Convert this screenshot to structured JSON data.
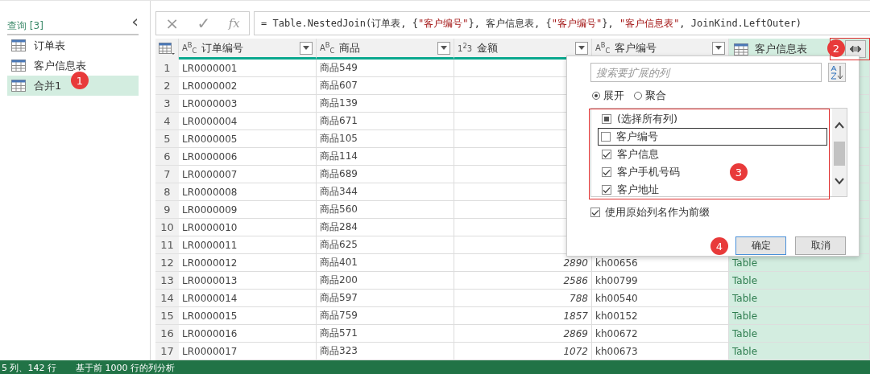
{
  "sidebar": {
    "title": "查询 [3]",
    "collapse": "‹",
    "items": [
      {
        "label": "订单表",
        "selected": false
      },
      {
        "label": "客户信息表",
        "selected": false
      },
      {
        "label": "合并1",
        "selected": true
      }
    ]
  },
  "formula_bar": {
    "cancel": "×",
    "confirm": "✓",
    "fx": "fx",
    "segments": [
      {
        "kind": "code",
        "text": "= Table.NestedJoin(订单表, {"
      },
      {
        "kind": "string",
        "text": "\"客户编号\""
      },
      {
        "kind": "code",
        "text": "}, 客户信息表, {"
      },
      {
        "kind": "string",
        "text": "\"客户编号\""
      },
      {
        "kind": "code",
        "text": "}, "
      },
      {
        "kind": "string",
        "text": "\"客户信息表\""
      },
      {
        "kind": "code",
        "text": ", JoinKind.LeftOuter)"
      }
    ]
  },
  "table": {
    "columns": [
      {
        "kind": "text",
        "type_label": "A$^{B}$$_{C}$",
        "name": "订单编号"
      },
      {
        "kind": "text",
        "type_label": "A$^{B}$$_{C}$",
        "name": "商品"
      },
      {
        "kind": "number",
        "type_label": "1$^{2}$3",
        "name": "金额"
      },
      {
        "kind": "text",
        "type_label": "A$^{B}$$_{C}$",
        "name": "客户编号"
      },
      {
        "kind": "table",
        "name": "客户信息表"
      }
    ],
    "rows": [
      {
        "n": "1",
        "cells": [
          "LR0000001",
          "商品549"
        ]
      },
      {
        "n": "2",
        "cells": [
          "LR0000002",
          "商品607"
        ]
      },
      {
        "n": "3",
        "cells": [
          "LR0000003",
          "商品139"
        ]
      },
      {
        "n": "4",
        "cells": [
          "LR0000004",
          "商品671"
        ]
      },
      {
        "n": "5",
        "cells": [
          "LR0000005",
          "商品105"
        ]
      },
      {
        "n": "6",
        "cells": [
          "LR0000006",
          "商品114"
        ]
      },
      {
        "n": "7",
        "cells": [
          "LR0000007",
          "商品689"
        ]
      },
      {
        "n": "8",
        "cells": [
          "LR0000008",
          "商品344"
        ]
      },
      {
        "n": "9",
        "cells": [
          "LR0000009",
          "商品560"
        ]
      },
      {
        "n": "10",
        "cells": [
          "LR0000010",
          "商品284"
        ]
      },
      {
        "n": "11",
        "cells": [
          "LR0000011",
          "商品625"
        ]
      },
      {
        "n": "12",
        "cells": [
          "LR0000012",
          "商品401",
          "2890",
          "kh00656",
          "Table"
        ]
      },
      {
        "n": "13",
        "cells": [
          "LR0000013",
          "商品200",
          "2586",
          "kh00799",
          "Table"
        ]
      },
      {
        "n": "14",
        "cells": [
          "LR0000014",
          "商品597",
          "788",
          "kh00540",
          "Table"
        ]
      },
      {
        "n": "15",
        "cells": [
          "LR0000015",
          "商品759",
          "1857",
          "kh00152",
          "Table"
        ]
      },
      {
        "n": "16",
        "cells": [
          "LR0000016",
          "商品571",
          "2869",
          "kh00672",
          "Table"
        ]
      },
      {
        "n": "17",
        "cells": [
          "LR0000017",
          "商品323",
          "1072",
          "kh00673",
          "Table"
        ]
      }
    ]
  },
  "expand_popup": {
    "search": {
      "placeholder": "搜索要扩展的列"
    },
    "modes": [
      {
        "label": "展开",
        "selected": true
      },
      {
        "label": "聚合",
        "selected": false
      }
    ],
    "columns": [
      {
        "kind": "all",
        "label": "(选择所有列)",
        "checked": false,
        "focused": false
      },
      {
        "kind": "column",
        "label": "客户编号",
        "checked": false,
        "focused": true
      },
      {
        "kind": "column",
        "label": "客户信息",
        "checked": true,
        "focused": false
      },
      {
        "kind": "column",
        "label": "客户手机号码",
        "checked": true,
        "focused": false
      },
      {
        "kind": "column",
        "label": "客户地址",
        "checked": true,
        "focused": false
      }
    ],
    "prefix": {
      "label": "使用原始列名作为前缀",
      "checked": true
    },
    "buttons": [
      {
        "label": "确定",
        "default": true
      },
      {
        "label": "取消",
        "default": false
      }
    ]
  },
  "annotations": [
    "1",
    "2",
    "3",
    "4"
  ],
  "status_bar": [
    "5 列、142 行",
    "基于前 1000 行的列分析"
  ]
}
